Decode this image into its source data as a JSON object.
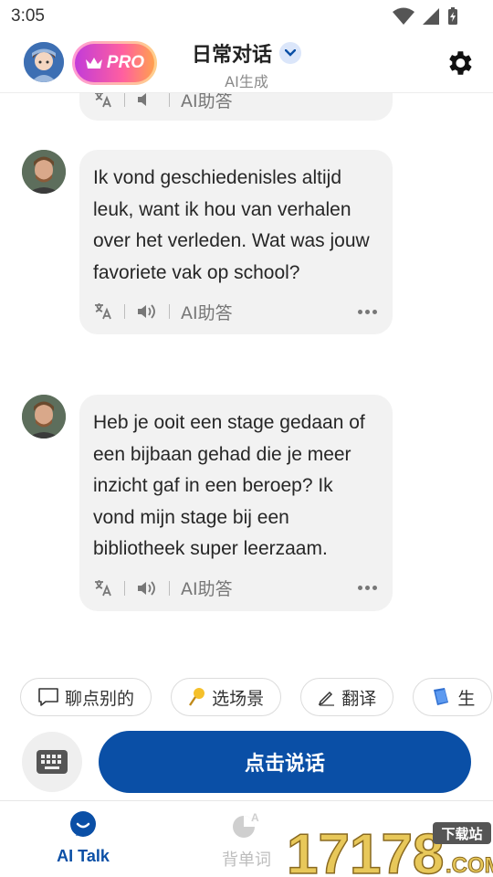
{
  "status_bar": {
    "time": "3:05"
  },
  "header": {
    "pro_label": "PRO",
    "title": "日常对话",
    "subtitle": "AI生成"
  },
  "messages": [
    {
      "text": "",
      "actions": {
        "assist_label": "AI助答"
      },
      "partial": true
    },
    {
      "text": "Ik vond geschiedenisles altijd leuk, want ik hou van verhalen over het verleden. Wat was jouw favoriete vak op school?",
      "actions": {
        "assist_label": "AI助答"
      }
    },
    {
      "text": "Heb je ooit een stage gedaan of een bijbaan gehad die je meer inzicht gaf in een beroep? Ik vond mijn stage bij een bibliotheek super leerzaam.",
      "actions": {
        "assist_label": "AI助答"
      }
    }
  ],
  "chips": [
    {
      "label": "聊点别的",
      "icon": "speech-bubble-icon"
    },
    {
      "label": "选场景",
      "icon": "pin-icon"
    },
    {
      "label": "翻译",
      "icon": "pen-icon"
    },
    {
      "label": "生",
      "icon": "book-icon"
    }
  ],
  "input": {
    "talk_label": "点击说话"
  },
  "bottom_nav": {
    "items": [
      {
        "label": "AI Talk",
        "active": true
      },
      {
        "label": "背单词",
        "active": false
      }
    ]
  },
  "watermark": {
    "text": "17178",
    "badge": "下载站",
    "suffix": ".COM"
  },
  "colors": {
    "accent": "#0a4fa6",
    "bubble": "#f2f2f2"
  }
}
